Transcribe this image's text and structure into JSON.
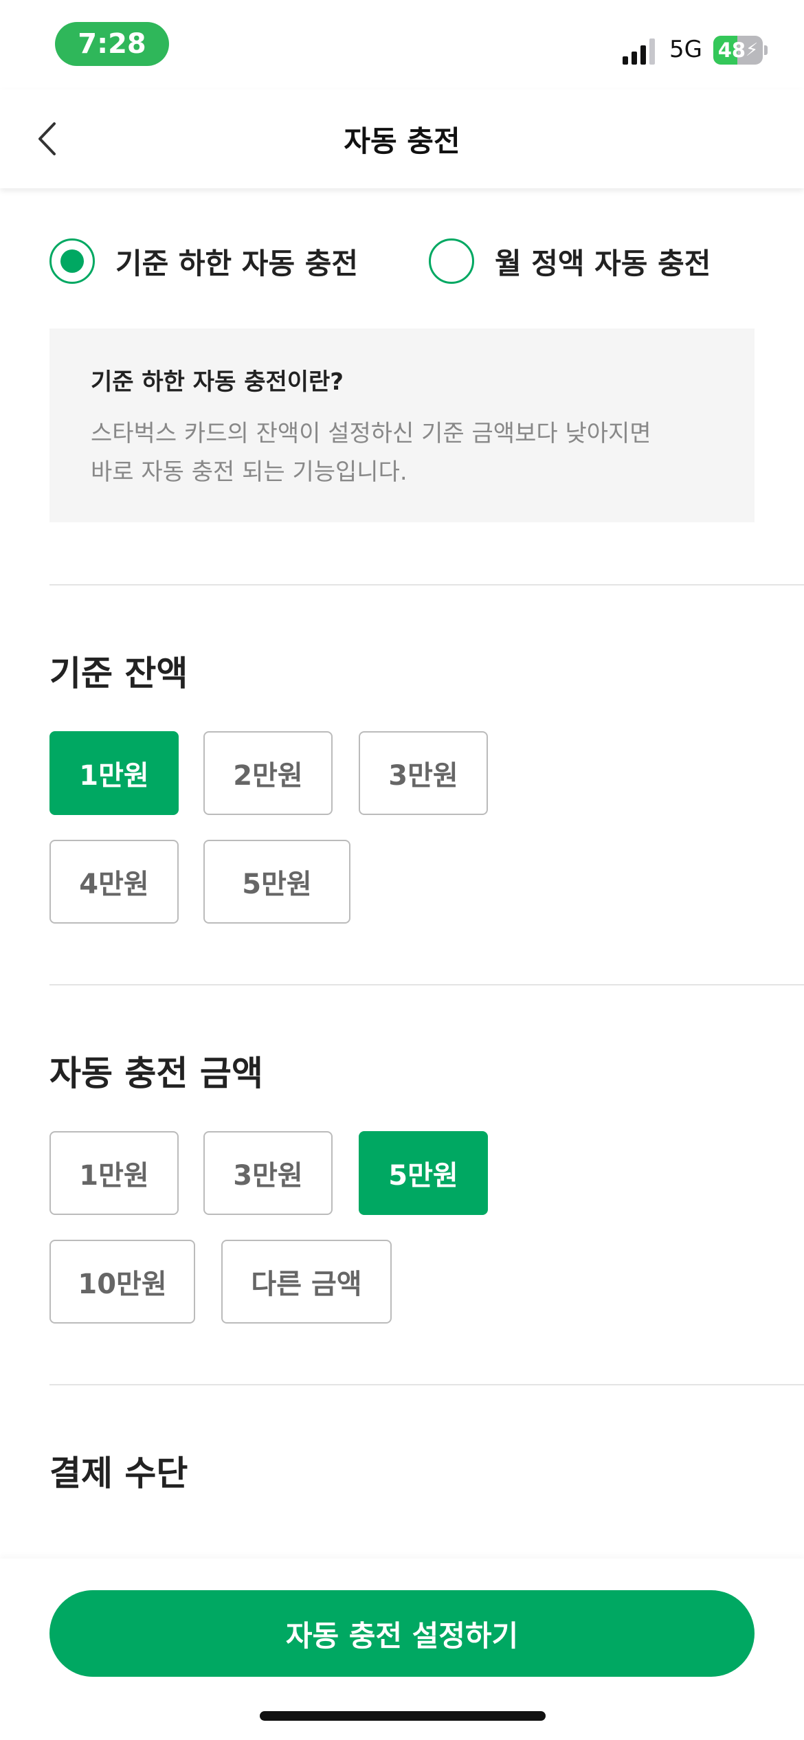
{
  "status_bar": {
    "time": "7:28",
    "network": "5G",
    "battery_percent": "48",
    "battery_level": 0.48,
    "charging": true,
    "time_pill_color": "#2fb75a"
  },
  "header": {
    "title": "자동 충전",
    "back_icon": "chevron-left-icon"
  },
  "charge_type": {
    "options": [
      {
        "label": "기준 하한 자동 충전",
        "checked": true
      },
      {
        "label": "월 정액 자동 충전",
        "checked": false
      }
    ]
  },
  "info": {
    "title": "기준 하한 자동 충전이란?",
    "line1": "스타벅스 카드의 잔액이 설정하신 기준 금액보다 낮아지면",
    "line2": "바로 자동 충전 되는 기능입니다."
  },
  "threshold": {
    "title": "기준 잔액",
    "options": [
      {
        "label": "1만원",
        "selected": true
      },
      {
        "label": "2만원",
        "selected": false
      },
      {
        "label": "3만원",
        "selected": false
      },
      {
        "label": "4만원",
        "selected": false
      },
      {
        "label": "5만원",
        "selected": false
      }
    ]
  },
  "charge_amount": {
    "title": "자동 충전 금액",
    "options": [
      {
        "label": "1만원",
        "selected": false
      },
      {
        "label": "3만원",
        "selected": false
      },
      {
        "label": "5만원",
        "selected": true
      },
      {
        "label": "10만원",
        "selected": false
      },
      {
        "label": "다른 금액",
        "selected": false
      }
    ]
  },
  "payment": {
    "title": "결제 수단"
  },
  "cta": {
    "label": "자동 충전 설정하기"
  },
  "colors": {
    "accent": "#00a862",
    "chip_border": "#bbbbbb",
    "info_bg": "#f5f5f5"
  }
}
